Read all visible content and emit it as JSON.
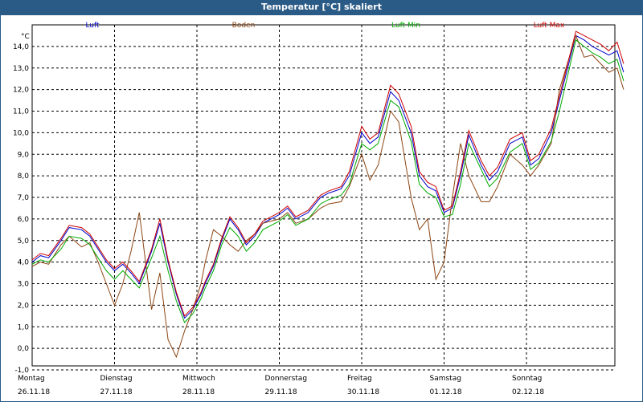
{
  "window": {
    "title": "Temperatur [°C] skaliert"
  },
  "colors": {
    "title_bg": "#2a5a86"
  },
  "chart_data": {
    "type": "line",
    "ylabel": "°C",
    "ylim": [
      -1.0,
      15.0
    ],
    "yticks": [
      "-1,0",
      "0,0",
      "1,0",
      "2,0",
      "3,0",
      "4,0",
      "5,0",
      "6,0",
      "7,0",
      "8,0",
      "9,0",
      "10,0",
      "11,0",
      "12,0",
      "13,0",
      "14,0"
    ],
    "xlim": [
      0,
      7.18
    ],
    "day_labels": [
      {
        "day": "Montag",
        "date": "26.11.18"
      },
      {
        "day": "Dienstag",
        "date": "27.11.18"
      },
      {
        "day": "Mittwoch",
        "date": "28.11.18"
      },
      {
        "day": "Donnerstag",
        "date": "29.11.18"
      },
      {
        "day": "Freitag",
        "date": "30.11.18"
      },
      {
        "day": "Samstag",
        "date": "01.12.18"
      },
      {
        "day": "Sonntag",
        "date": "02.12.18"
      }
    ],
    "grid": true,
    "legend_position": "top",
    "series": [
      {
        "name": "Luft",
        "color": "#0000cc",
        "x": [
          0,
          0.1,
          0.2,
          0.35,
          0.45,
          0.6,
          0.7,
          0.8,
          0.9,
          1.0,
          1.1,
          1.2,
          1.3,
          1.45,
          1.55,
          1.65,
          1.75,
          1.85,
          1.95,
          2.05,
          2.1,
          2.2,
          2.3,
          2.4,
          2.5,
          2.6,
          2.7,
          2.8,
          3.0,
          3.1,
          3.2,
          3.35,
          3.5,
          3.6,
          3.75,
          3.85,
          4.0,
          4.1,
          4.2,
          4.35,
          4.45,
          4.6,
          4.7,
          4.8,
          4.9,
          5.0,
          5.1,
          5.2,
          5.3,
          5.45,
          5.55,
          5.65,
          5.8,
          5.95,
          6.05,
          6.15,
          6.3,
          6.4,
          6.6,
          6.7,
          6.8,
          6.9,
          7.0,
          7.1,
          7.18
        ],
        "values": [
          4.0,
          4.3,
          4.2,
          5.0,
          5.6,
          5.5,
          5.2,
          4.6,
          4.0,
          3.6,
          3.9,
          3.5,
          3.0,
          4.5,
          5.8,
          4.0,
          2.5,
          1.4,
          1.8,
          2.5,
          3.0,
          3.8,
          5.0,
          6.0,
          5.5,
          4.8,
          5.2,
          5.8,
          6.2,
          6.5,
          6.0,
          6.3,
          7.0,
          7.2,
          7.4,
          8.0,
          10.0,
          9.5,
          9.8,
          11.9,
          11.5,
          10.0,
          8.0,
          7.5,
          7.3,
          6.3,
          6.5,
          8.0,
          9.9,
          8.5,
          7.8,
          8.2,
          9.5,
          9.8,
          8.5,
          8.8,
          10.0,
          11.5,
          14.5,
          14.3,
          14.0,
          13.8,
          13.6,
          13.8,
          12.8
        ]
      },
      {
        "name": "Boden",
        "color": "#8b4513",
        "x": [
          0,
          0.1,
          0.2,
          0.35,
          0.45,
          0.6,
          0.7,
          0.8,
          0.9,
          1.0,
          1.1,
          1.2,
          1.3,
          1.45,
          1.55,
          1.65,
          1.75,
          1.85,
          1.95,
          2.05,
          2.1,
          2.2,
          2.3,
          2.4,
          2.5,
          2.6,
          2.7,
          2.8,
          3.0,
          3.1,
          3.2,
          3.35,
          3.5,
          3.6,
          3.75,
          3.85,
          4.0,
          4.1,
          4.2,
          4.35,
          4.45,
          4.6,
          4.7,
          4.8,
          4.9,
          5.0,
          5.1,
          5.2,
          5.3,
          5.45,
          5.55,
          5.65,
          5.8,
          5.95,
          6.05,
          6.15,
          6.3,
          6.4,
          6.6,
          6.7,
          6.8,
          6.9,
          7.0,
          7.1,
          7.18
        ],
        "values": [
          3.8,
          4.0,
          3.9,
          4.8,
          5.2,
          4.7,
          4.9,
          4.0,
          3.0,
          2.0,
          3.0,
          4.5,
          6.3,
          1.8,
          3.5,
          0.4,
          -0.4,
          0.8,
          1.8,
          3.0,
          4.0,
          5.5,
          5.2,
          4.8,
          4.5,
          5.0,
          5.3,
          5.8,
          6.0,
          6.3,
          5.8,
          6.0,
          6.5,
          6.7,
          6.8,
          7.5,
          9.0,
          7.8,
          8.5,
          11.0,
          10.5,
          7.0,
          5.5,
          6.0,
          3.2,
          4.0,
          7.0,
          9.5,
          8.0,
          6.8,
          6.8,
          7.5,
          9.0,
          8.5,
          8.0,
          8.5,
          9.5,
          12.0,
          14.5,
          13.5,
          13.6,
          13.2,
          12.8,
          13.0,
          12.0
        ]
      },
      {
        "name": "Luft Min",
        "color": "#00aa00",
        "x": [
          0,
          0.1,
          0.2,
          0.35,
          0.45,
          0.6,
          0.7,
          0.8,
          0.9,
          1.0,
          1.1,
          1.2,
          1.3,
          1.45,
          1.55,
          1.65,
          1.75,
          1.85,
          1.95,
          2.05,
          2.1,
          2.2,
          2.3,
          2.4,
          2.5,
          2.6,
          2.7,
          2.8,
          3.0,
          3.1,
          3.2,
          3.35,
          3.5,
          3.6,
          3.75,
          3.85,
          4.0,
          4.1,
          4.2,
          4.35,
          4.45,
          4.6,
          4.7,
          4.8,
          4.9,
          5.0,
          5.1,
          5.2,
          5.3,
          5.45,
          5.55,
          5.65,
          5.8,
          5.95,
          6.05,
          6.15,
          6.3,
          6.4,
          6.6,
          6.7,
          6.8,
          6.9,
          7.0,
          7.1,
          7.18
        ],
        "values": [
          3.9,
          4.1,
          4.0,
          4.6,
          5.2,
          5.1,
          4.8,
          4.2,
          3.6,
          3.2,
          3.6,
          3.2,
          2.8,
          4.2,
          5.2,
          3.6,
          2.2,
          1.2,
          1.6,
          2.3,
          2.8,
          3.6,
          4.8,
          5.6,
          5.2,
          4.5,
          4.9,
          5.5,
          5.9,
          6.2,
          5.7,
          6.0,
          6.7,
          6.9,
          7.1,
          7.6,
          9.5,
          9.2,
          9.5,
          11.5,
          11.2,
          9.6,
          7.6,
          7.2,
          7.0,
          6.1,
          6.2,
          7.6,
          9.5,
          8.3,
          7.5,
          7.9,
          9.1,
          9.5,
          8.3,
          8.6,
          9.6,
          11.0,
          14.3,
          14.0,
          13.7,
          13.5,
          13.2,
          13.4,
          12.4
        ]
      },
      {
        "name": "Luft Max",
        "color": "#cc0000",
        "x": [
          0,
          0.1,
          0.2,
          0.35,
          0.45,
          0.6,
          0.7,
          0.8,
          0.9,
          1.0,
          1.1,
          1.2,
          1.3,
          1.45,
          1.55,
          1.65,
          1.75,
          1.85,
          1.95,
          2.05,
          2.1,
          2.2,
          2.3,
          2.4,
          2.5,
          2.6,
          2.7,
          2.8,
          3.0,
          3.1,
          3.2,
          3.35,
          3.5,
          3.6,
          3.75,
          3.85,
          4.0,
          4.1,
          4.2,
          4.35,
          4.45,
          4.6,
          4.7,
          4.8,
          4.9,
          5.0,
          5.1,
          5.2,
          5.3,
          5.45,
          5.55,
          5.65,
          5.8,
          5.95,
          6.05,
          6.15,
          6.3,
          6.4,
          6.6,
          6.7,
          6.8,
          6.9,
          7.0,
          7.1,
          7.18
        ],
        "values": [
          4.1,
          4.4,
          4.3,
          5.1,
          5.7,
          5.6,
          5.3,
          4.7,
          4.1,
          3.7,
          4.0,
          3.6,
          3.1,
          4.6,
          6.0,
          4.1,
          2.6,
          1.5,
          1.9,
          2.6,
          3.1,
          3.9,
          5.1,
          6.1,
          5.6,
          4.9,
          5.3,
          5.9,
          6.3,
          6.6,
          6.1,
          6.4,
          7.1,
          7.3,
          7.5,
          8.2,
          10.3,
          9.7,
          10.0,
          12.2,
          11.8,
          10.3,
          8.2,
          7.7,
          7.5,
          6.4,
          6.6,
          8.2,
          10.1,
          8.7,
          8.0,
          8.4,
          9.7,
          10.0,
          8.7,
          9.0,
          10.2,
          11.7,
          14.7,
          14.5,
          14.3,
          14.1,
          13.8,
          14.2,
          13.2
        ]
      }
    ]
  }
}
